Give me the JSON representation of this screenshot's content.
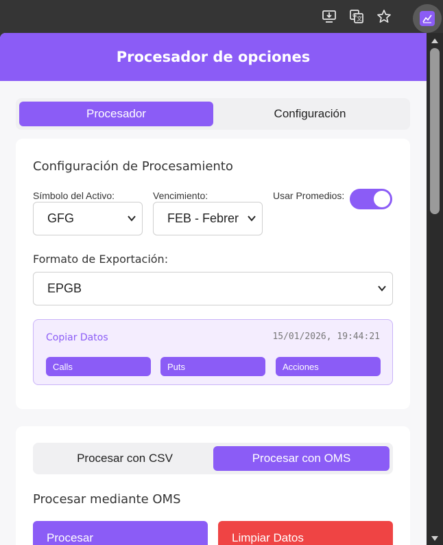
{
  "browser": {
    "icons": [
      "download-icon",
      "translate-icon",
      "star-icon",
      "extension-icon"
    ]
  },
  "header": {
    "title": "Procesador de opciones"
  },
  "tabs": [
    {
      "label": "Procesador",
      "active": true
    },
    {
      "label": "Configuración",
      "active": false
    }
  ],
  "processing": {
    "title": "Configuración de Procesamiento",
    "symbol_label": "Símbolo del Activo:",
    "symbol_value": "GFG",
    "expiry_label": "Vencimiento:",
    "expiry_value": "FEB - Febrero",
    "averages_label": "Usar Promedios:",
    "averages_on": true,
    "export_label": "Formato de Exportación:",
    "export_value": "EPGB"
  },
  "copy": {
    "title": "Copiar Datos",
    "timestamp": "15/01/2026, 19:44:21",
    "buttons": [
      "Calls",
      "Puts",
      "Acciones"
    ]
  },
  "process": {
    "tabs": [
      {
        "label": "Procesar con CSV",
        "active": false
      },
      {
        "label": "Procesar con OMS",
        "active": true
      }
    ],
    "title": "Procesar mediante OMS",
    "process_button": "Procesar",
    "clear_button": "Limpiar Datos"
  },
  "colors": {
    "accent": "#8b5cf6",
    "danger": "#ef4444"
  }
}
